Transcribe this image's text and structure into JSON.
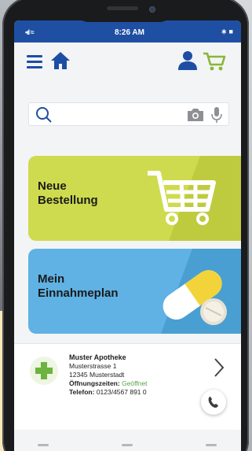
{
  "status": {
    "signal": "•ıl ≈",
    "time": "8:26 AM",
    "battery": "∗ ■"
  },
  "toolbar": {
    "menu_icon": "hamburger-icon",
    "home_icon": "home-icon",
    "account_icon": "user-icon",
    "cart_icon": "cart-icon"
  },
  "search": {
    "placeholder": "",
    "search_icon": "search-icon",
    "camera_icon": "camera-icon",
    "mic_icon": "microphone-icon"
  },
  "tiles": [
    {
      "label_line1": "Neue",
      "label_line2": "Bestellung",
      "icon": "shopping-cart-icon",
      "color": "#cfdb4f"
    },
    {
      "label_line1": "Mein",
      "label_line2": "Einnahmeplan",
      "icon": "pills-icon",
      "color": "#5fb2e3"
    }
  ],
  "pharmacy": {
    "name": "Muster Apotheke",
    "street": "Musterstrasse 1",
    "city": "12345 Musterstadt",
    "hours_label": "Öffnungszeiten:",
    "hours_value": "Geöffnet",
    "phone_label": "Telefon:",
    "phone_value": "0123/4567 891 0"
  },
  "colors": {
    "brand_blue": "#1d4ea3",
    "accent_green": "#8ab637",
    "tile_green": "#cfdb4f",
    "tile_blue": "#5fb2e3"
  }
}
